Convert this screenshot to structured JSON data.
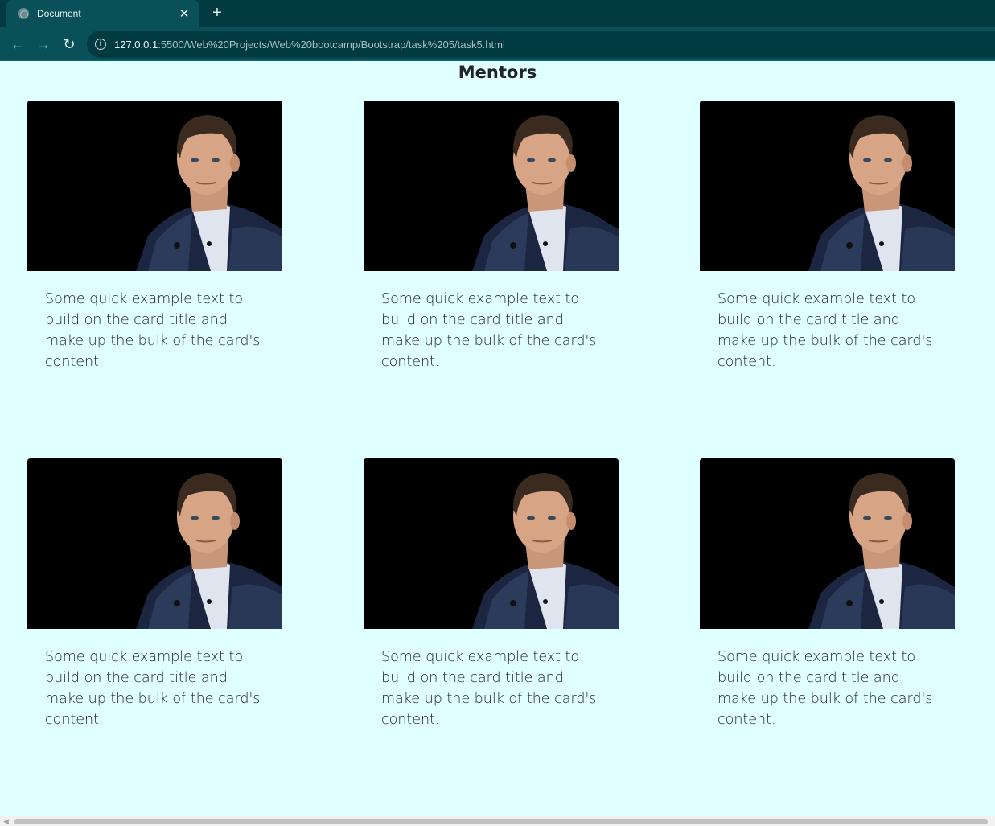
{
  "browser": {
    "tab_title": "Document",
    "tab_close": "✕",
    "new_tab": "+",
    "url_host": "127.0.0.1",
    "url_rest": ":5500/Web%20Projects/Web%20bootcamp/Bootstrap/task%205/task5.html"
  },
  "page": {
    "heading": "Mentors"
  },
  "cards": [
    {
      "text": "Some quick example text to build on the card title and make up the bulk of the card's content."
    },
    {
      "text": "Some quick example text to build on the card title and make up the bulk of the card's content."
    },
    {
      "text": "Some quick example text to build on the card title and make up the bulk of the card's content."
    },
    {
      "text": "Some quick example text to build on the card title and make up the bulk of the card's content."
    },
    {
      "text": "Some quick example text to build on the card title and make up the bulk of the card's content."
    },
    {
      "text": "Some quick example text to build on the card title and make up the bulk of the card's content."
    }
  ]
}
